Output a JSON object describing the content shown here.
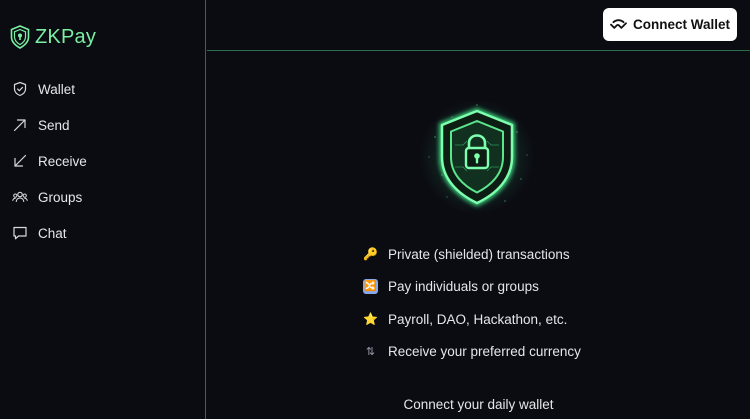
{
  "app": {
    "name": "ZKPay",
    "accent_color": "#79f0a3",
    "border_color": "#2a6e4f",
    "background_color": "#0b0b12"
  },
  "sidebar": {
    "items": [
      {
        "label": "Wallet",
        "icon": "shield-check-icon"
      },
      {
        "label": "Send",
        "icon": "arrow-up-right-icon"
      },
      {
        "label": "Receive",
        "icon": "arrow-down-left-icon"
      },
      {
        "label": "Groups",
        "icon": "users-icon"
      },
      {
        "label": "Chat",
        "icon": "chat-bubble-icon"
      }
    ]
  },
  "header": {
    "connect_button_label": "Connect Wallet",
    "connect_button_icon": "walletconnect-icon"
  },
  "main": {
    "hero_icon": "glowing-shield-lock-icon",
    "features": [
      {
        "emoji": "🔑",
        "icon": "key-icon",
        "text": "Private (shielded) transactions"
      },
      {
        "emoji": "🔀",
        "icon": "shuffle-icon",
        "text": "Pay individuals or groups"
      },
      {
        "emoji": "⭐",
        "icon": "star-icon",
        "text": "Payroll, DAO, Hackathon, etc."
      },
      {
        "emoji": "⇅",
        "icon": "exchange-arrows-icon",
        "text": "Receive your preferred currency"
      }
    ],
    "cta_text": "Connect your daily wallet"
  }
}
